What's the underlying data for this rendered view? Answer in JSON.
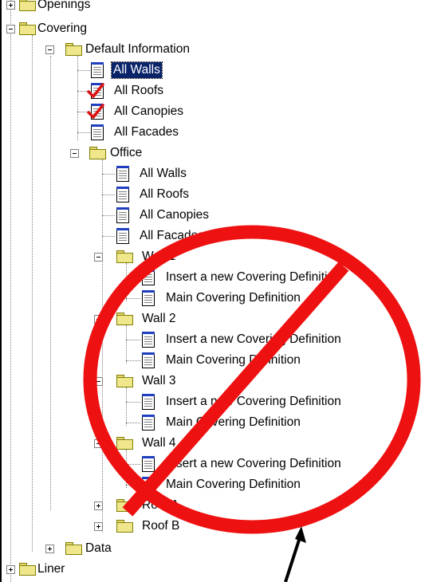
{
  "tree": {
    "nodes": [
      {
        "label": "Openings",
        "icon": "folder-icon",
        "expander": "plus"
      },
      {
        "label": "Covering",
        "icon": "folder-icon",
        "expander": "minus"
      },
      {
        "label": "Default Information",
        "icon": "folder-icon",
        "expander": "minus"
      },
      {
        "label": "All Walls",
        "icon": "document-icon",
        "selected": true
      },
      {
        "label": "All Roofs",
        "icon": "checked-document-icon"
      },
      {
        "label": "All Canopies",
        "icon": "checked-document-icon"
      },
      {
        "label": "All Facades",
        "icon": "document-icon"
      },
      {
        "label": "Office",
        "icon": "folder-icon",
        "expander": "minus"
      },
      {
        "label": "All Walls",
        "icon": "document-icon"
      },
      {
        "label": "All Roofs",
        "icon": "document-icon"
      },
      {
        "label": "All Canopies",
        "icon": "document-icon"
      },
      {
        "label": "All Facades",
        "icon": "document-icon"
      },
      {
        "label": "Wall 1",
        "icon": "folder-icon",
        "expander": "minus"
      },
      {
        "label": "Insert a new Covering Definition",
        "icon": "document-icon"
      },
      {
        "label": "Main Covering Definition",
        "icon": "document-icon"
      },
      {
        "label": "Wall 2",
        "icon": "folder-icon",
        "expander": "minus"
      },
      {
        "label": "Insert a new Covering Definition",
        "icon": "document-icon"
      },
      {
        "label": "Main Covering Definition",
        "icon": "document-icon"
      },
      {
        "label": "Wall 3",
        "icon": "folder-icon",
        "expander": "minus"
      },
      {
        "label": "Insert a new Covering Definition",
        "icon": "document-icon"
      },
      {
        "label": "Main Covering Definition",
        "icon": "document-icon"
      },
      {
        "label": "Wall 4",
        "icon": "folder-icon",
        "expander": "minus"
      },
      {
        "label": "Insert a new Covering Definition",
        "icon": "document-icon"
      },
      {
        "label": "Main Covering Definition",
        "icon": "document-icon"
      },
      {
        "label": "Roof A",
        "icon": "folder-icon",
        "expander": "plus"
      },
      {
        "label": "Roof B",
        "icon": "folder-icon",
        "expander": "plus"
      },
      {
        "label": "Data",
        "icon": "folder-icon",
        "expander": "plus"
      },
      {
        "label": "Liner",
        "icon": "folder-icon",
        "expander": "plus"
      }
    ]
  },
  "overlay": {
    "symbol": "prohibition-sign",
    "color": "#ee1111",
    "pointer_arrow_color": "#000000"
  },
  "colors": {
    "selection_bg": "#0a246a",
    "selection_fg": "#ffffff",
    "folder_fill": "#f0e68c",
    "check_color": "#dd1111"
  }
}
